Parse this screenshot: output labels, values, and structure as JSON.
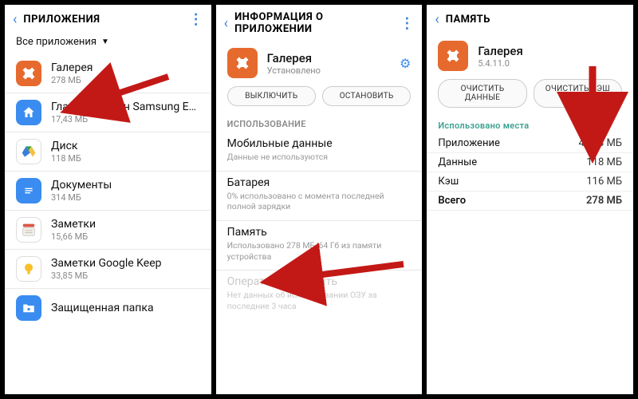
{
  "panel1": {
    "title": "ПРИЛОЖЕНИЯ",
    "filter": "Все приложения",
    "items": [
      {
        "name": "Галерея",
        "sub": "278 МБ"
      },
      {
        "name": "Главный экран Samsung Experie..",
        "sub": "17,43 МБ"
      },
      {
        "name": "Диск",
        "sub": "118 МБ"
      },
      {
        "name": "Документы",
        "sub": "314 МБ"
      },
      {
        "name": "Заметки",
        "sub": "15,66 МБ"
      },
      {
        "name": "Заметки Google Keep",
        "sub": "33,85 МБ"
      },
      {
        "name": "Защищенная папка",
        "sub": ""
      }
    ]
  },
  "panel2": {
    "title": "ИНФОРМАЦИЯ О ПРИЛОЖЕНИИ",
    "app_name": "Галерея",
    "app_sub": "Установлено",
    "btn_disable": "ВЫКЛЮЧИТЬ",
    "btn_stop": "ОСТАНОВИТЬ",
    "usage_header": "ИСПОЛЬЗОВАНИЕ",
    "rows": [
      {
        "title": "Мобильные данные",
        "sub": "Данные не используются"
      },
      {
        "title": "Батарея",
        "sub": "0% использовано с момента последней полной зарядки"
      },
      {
        "title": "Память",
        "sub": "Использовано 278 МБ/64 Гб из памяти устройства"
      },
      {
        "title": "Оперативная память",
        "sub": "Нет данных об использовании ОЗУ за последние 3 часа"
      }
    ]
  },
  "panel3": {
    "title": "ПАМЯТЬ",
    "app_name": "Галерея",
    "app_sub": "5.4.11.0",
    "btn_clear_data": "ОЧИСТИТЬ ДАННЫЕ",
    "btn_clear_cache": "ОЧИСТИТЬ КЭШ",
    "usage_header": "Использовано места",
    "rows": [
      {
        "label": "Приложение",
        "val": "44,04 МБ"
      },
      {
        "label": "Данные",
        "val": "118 МБ"
      },
      {
        "label": "Кэш",
        "val": "116 МБ"
      },
      {
        "label": "Всего",
        "val": "278 МБ"
      }
    ]
  }
}
